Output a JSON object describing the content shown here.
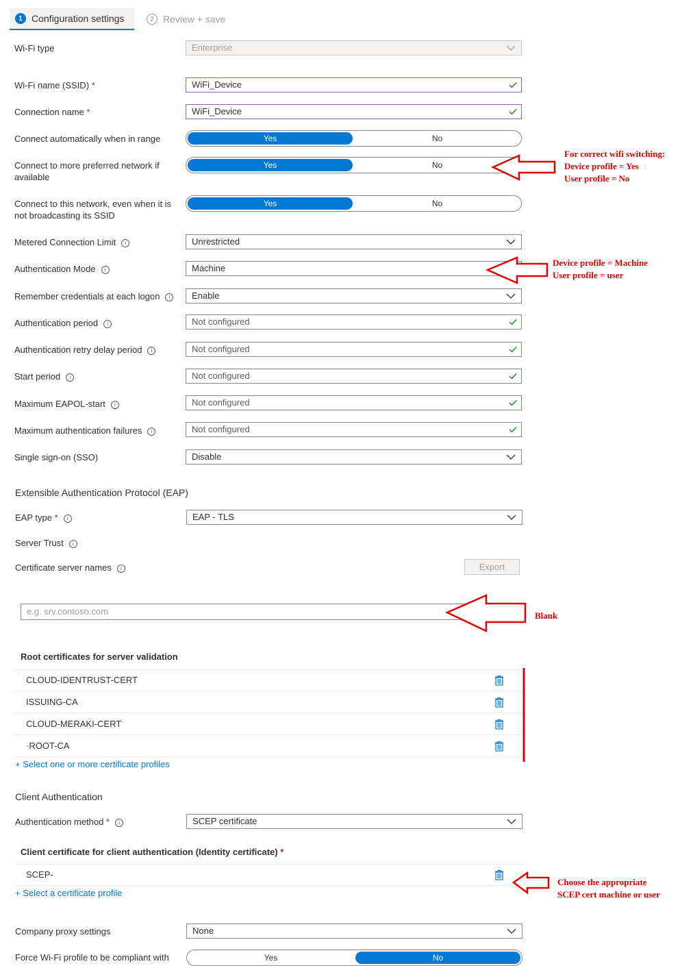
{
  "tabs": [
    {
      "step": "1",
      "label": "Configuration settings"
    },
    {
      "step": "2",
      "label": "Review + save"
    }
  ],
  "fields": {
    "wifi_type": {
      "label": "Wi-Fi type",
      "value": "Enterprise"
    },
    "ssid": {
      "label": "Wi-Fi name (SSID)",
      "value": "WiFi_Device"
    },
    "connection_name": {
      "label": "Connection name",
      "value": "WiFi_Device"
    },
    "connect_auto": {
      "label": "Connect automatically when in range",
      "yes": "Yes",
      "no": "No",
      "selected": "Yes"
    },
    "connect_preferred": {
      "label": "Connect to more preferred network if available",
      "yes": "Yes",
      "no": "No",
      "selected": "Yes"
    },
    "connect_hidden": {
      "label": "Connect to this network, even when it is not broadcasting its SSID",
      "yes": "Yes",
      "no": "No",
      "selected": "Yes"
    },
    "metered": {
      "label": "Metered Connection Limit",
      "value": "Unrestricted"
    },
    "auth_mode": {
      "label": "Authentication Mode",
      "value": "Machine"
    },
    "remember_creds": {
      "label": "Remember credentials at each logon",
      "value": "Enable"
    },
    "auth_period": {
      "label": "Authentication period",
      "value": "Not configured"
    },
    "auth_retry": {
      "label": "Authentication retry delay period",
      "value": "Not configured"
    },
    "start_period": {
      "label": "Start period",
      "value": "Not configured"
    },
    "max_eapol": {
      "label": "Maximum EAPOL-start",
      "value": "Not configured"
    },
    "max_auth_fail": {
      "label": "Maximum authentication failures",
      "value": "Not configured"
    },
    "sso": {
      "label": "Single sign-on (SSO)",
      "value": "Disable"
    }
  },
  "eap": {
    "section_title": "Extensible Authentication Protocol (EAP)",
    "eap_type_label": "EAP type",
    "eap_type_value": "EAP - TLS",
    "server_trust": "Server Trust",
    "cert_server_names_label": "Certificate server names",
    "export_label": "Export",
    "server_placeholder": "e.g. srv.contoso.com",
    "root_certs_title": "Root certificates for server validation",
    "root_certs": [
      "CLOUD-IDENTRUST-CERT",
      "ISSUING-CA",
      "CLOUD-MERAKI-CERT",
      "·ROOT-CA"
    ],
    "select_profiles_link": "+ Select one or more certificate profiles"
  },
  "client_auth": {
    "section_title": "Client Authentication",
    "method_label": "Authentication method",
    "method_value": "SCEP certificate",
    "client_cert_title": "Client certificate for client authentication (Identity certificate)",
    "client_cert": "SCEP-",
    "select_profile_link": "+ Select a certificate profile"
  },
  "proxy": {
    "label": "Company proxy settings",
    "value": "None"
  },
  "force_compliant": {
    "label": "Force Wi-Fi profile to be compliant with",
    "yes": "Yes",
    "no": "No",
    "selected": "No"
  },
  "annotations": {
    "switching": [
      "For correct wifi switching:",
      "Device profile = Yes",
      "User profile = No"
    ],
    "auth_mode": [
      "Device profile = Machine",
      "User profile = user"
    ],
    "blank": "Blank",
    "scep": [
      "Choose the appropriate",
      "SCEP cert  machine or user"
    ]
  },
  "colors": {
    "accent": "#0078d4",
    "annotation": "#e00000",
    "valid_check": "#107c10"
  }
}
